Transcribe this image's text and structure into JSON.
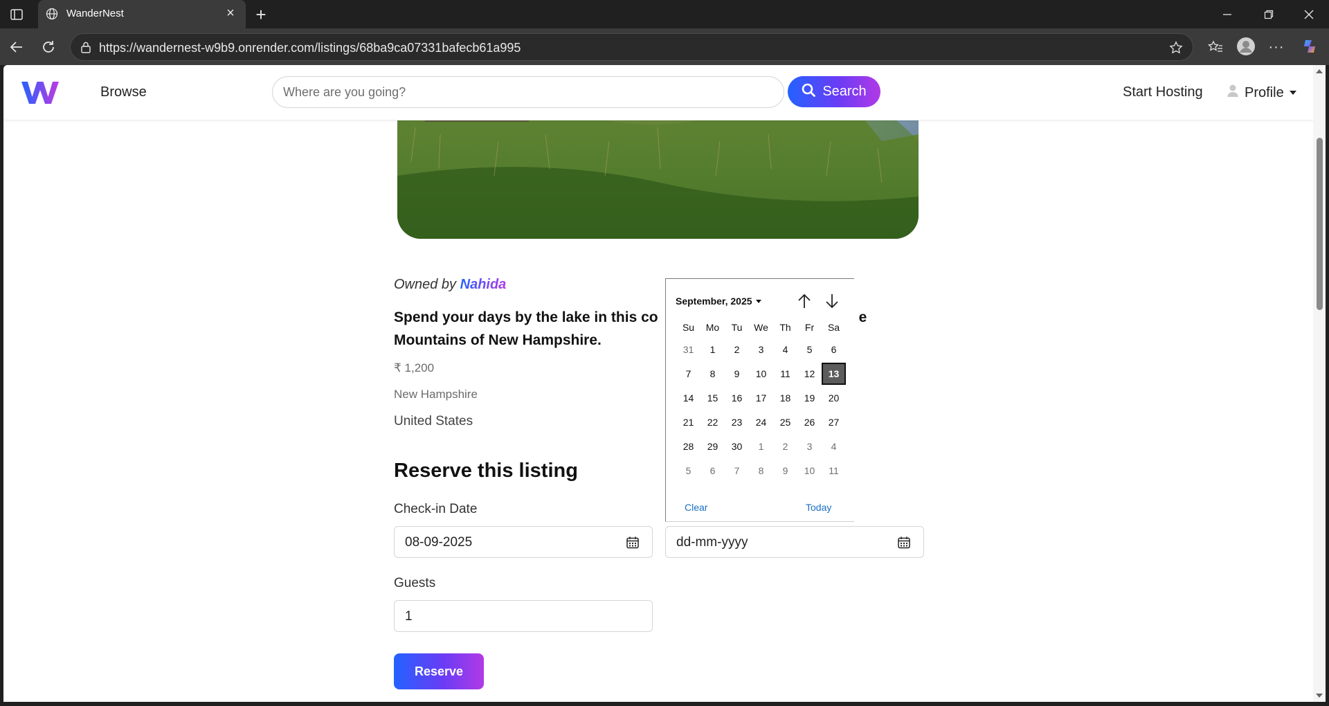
{
  "browser": {
    "tab_title": "WanderNest",
    "url": "https://wandernest-w9b9.onrender.com/listings/68ba9ca07331bafecb61a995"
  },
  "header": {
    "browse_label": "Browse",
    "search_placeholder": "Where are you going?",
    "search_button_label": "Search",
    "start_hosting_label": "Start Hosting",
    "profile_label": "Profile"
  },
  "listing": {
    "owned_by_prefix": "Owned by",
    "owner_name": "Nahida",
    "description_before": "Spend your days by the lake in this co",
    "description_after_gap": "e",
    "description_line2": "Mountains of New Hampshire.",
    "price": "₹ 1,200",
    "location": "New Hampshire",
    "country": "United States"
  },
  "reservation": {
    "heading": "Reserve this listing",
    "checkin_label": "Check-in Date",
    "checkin_value": "08-09-2025",
    "checkout_placeholder": "dd-mm-yyyy",
    "guests_label": "Guests",
    "guests_value": "1",
    "reserve_button_label": "Reserve"
  },
  "datepicker": {
    "month_label": "September, 2025",
    "weekdays": [
      "Su",
      "Mo",
      "Tu",
      "We",
      "Th",
      "Fr",
      "Sa"
    ],
    "weeks": [
      [
        {
          "d": "31",
          "m": true
        },
        {
          "d": "1"
        },
        {
          "d": "2"
        },
        {
          "d": "3"
        },
        {
          "d": "4"
        },
        {
          "d": "5"
        },
        {
          "d": "6"
        }
      ],
      [
        {
          "d": "7"
        },
        {
          "d": "8"
        },
        {
          "d": "9"
        },
        {
          "d": "10"
        },
        {
          "d": "11"
        },
        {
          "d": "12"
        },
        {
          "d": "13",
          "s": true
        }
      ],
      [
        {
          "d": "14"
        },
        {
          "d": "15"
        },
        {
          "d": "16"
        },
        {
          "d": "17"
        },
        {
          "d": "18"
        },
        {
          "d": "19"
        },
        {
          "d": "20"
        }
      ],
      [
        {
          "d": "21"
        },
        {
          "d": "22"
        },
        {
          "d": "23"
        },
        {
          "d": "24"
        },
        {
          "d": "25"
        },
        {
          "d": "26"
        },
        {
          "d": "27"
        }
      ],
      [
        {
          "d": "28"
        },
        {
          "d": "29"
        },
        {
          "d": "30"
        },
        {
          "d": "1",
          "m": true
        },
        {
          "d": "2",
          "m": true
        },
        {
          "d": "3",
          "m": true
        },
        {
          "d": "4",
          "m": true
        }
      ],
      [
        {
          "d": "5",
          "m": true
        },
        {
          "d": "6",
          "m": true
        },
        {
          "d": "7",
          "m": true
        },
        {
          "d": "8",
          "m": true
        },
        {
          "d": "9",
          "m": true
        },
        {
          "d": "10",
          "m": true
        },
        {
          "d": "11",
          "m": true
        }
      ]
    ],
    "clear_label": "Clear",
    "today_label": "Today"
  },
  "colors": {
    "brand_blue": "#2462ff",
    "brand_purple": "#b13ae6",
    "link_blue": "#1a6fc4",
    "selected_day": "#5c5c5c"
  },
  "icons": {
    "tab_favicon": "globe-icon",
    "search": "search-icon",
    "profile": "user-icon",
    "calendar": "calendar-icon"
  }
}
